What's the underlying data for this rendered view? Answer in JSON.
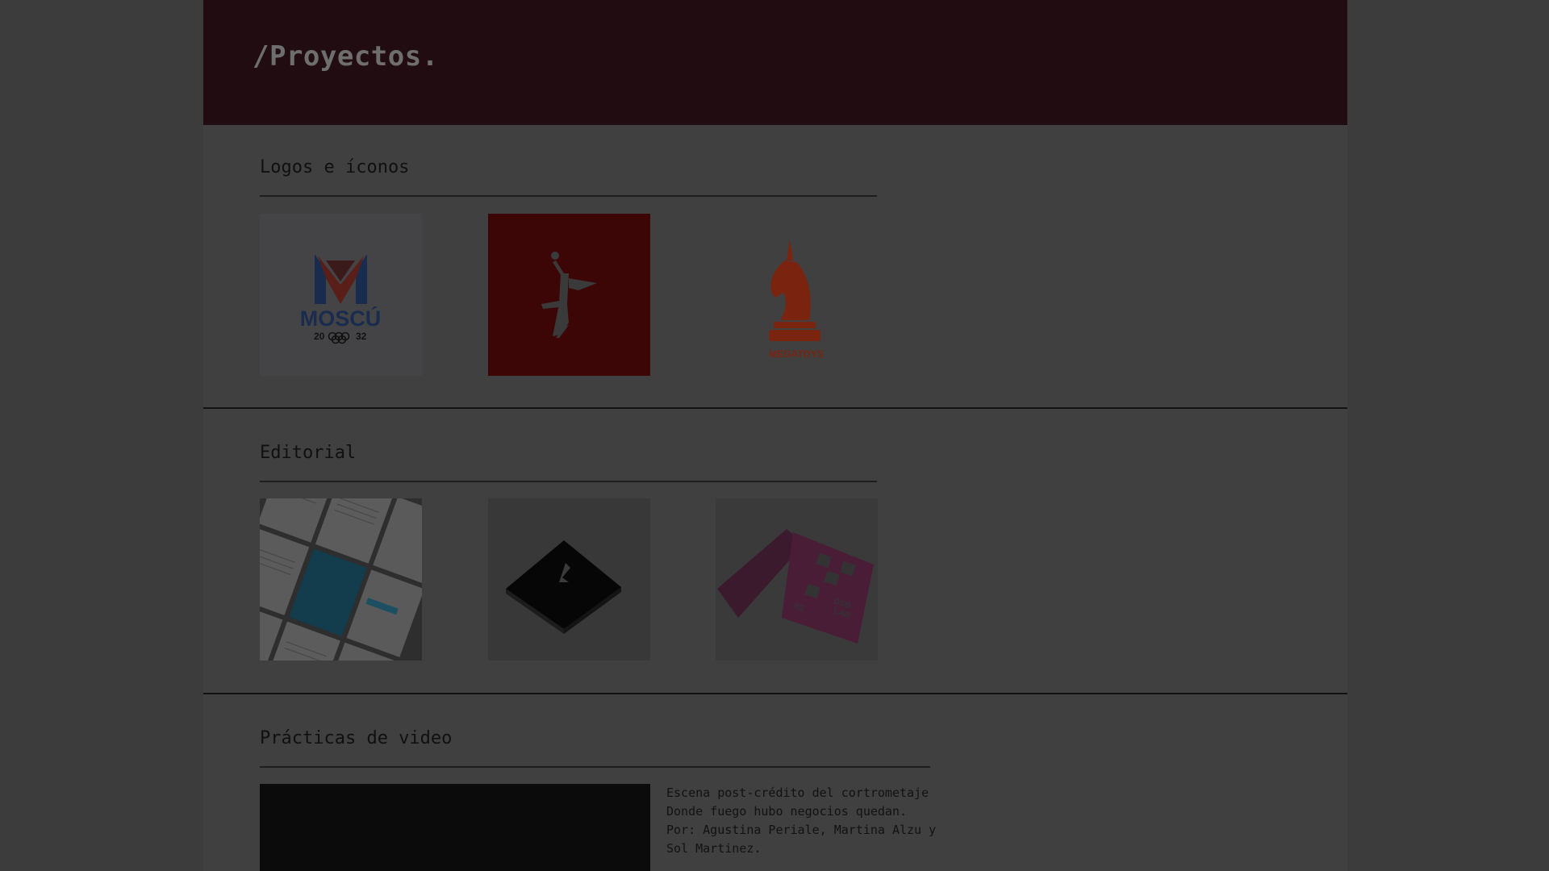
{
  "header": {
    "title": "/Proyectos."
  },
  "sections": {
    "logos": {
      "title": "Logos e íconos",
      "items": [
        {
          "name": "mosco-logo",
          "wordmark": "MOSCÚ",
          "year_left": "20",
          "year_right": "32"
        },
        {
          "name": "athlete-logo"
        },
        {
          "name": "megatoys-logo",
          "wordmark": "MEGATOYS"
        }
      ]
    },
    "editorial": {
      "title": "Editorial",
      "items": [
        {
          "name": "editorial-magazine-spread"
        },
        {
          "name": "editorial-black-book"
        },
        {
          "name": "editorial-magenta-brochure",
          "text_a": "DSB",
          "text_b": "LAB",
          "text_c": "R1"
        }
      ]
    },
    "video": {
      "title": "Prácticas de video",
      "desc_lines": [
        "Escena post-crédito del cortrometaje",
        "Donde fuego hubo negocios quedan.",
        "Por: Agustina Periale, Martina Alzu y",
        "Sol Martinez."
      ]
    }
  },
  "colors": {
    "overlay_bg": "#3c3c3c",
    "header_bg": "#200c11",
    "athlete_tile": "#3d0606",
    "accent_red": "#7a2410",
    "navy": "#1a2c4e"
  }
}
